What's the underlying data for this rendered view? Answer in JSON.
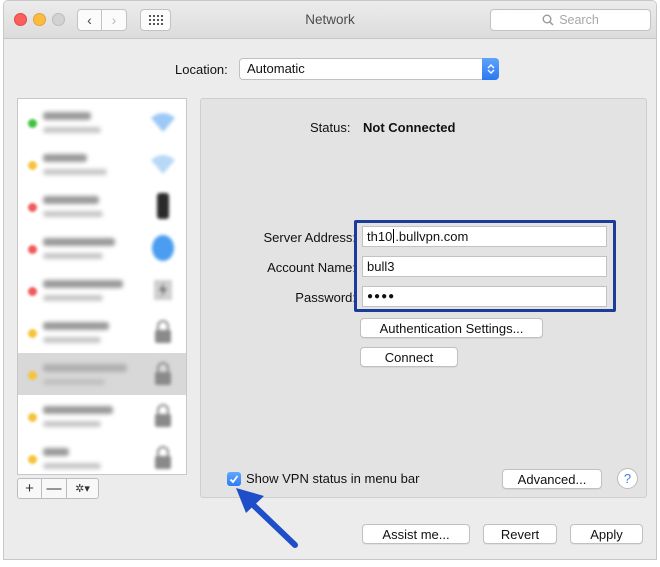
{
  "window": {
    "title": "Network",
    "search_placeholder": "Search"
  },
  "toolbar": {
    "back_glyph": "‹",
    "forward_glyph": "›"
  },
  "location": {
    "label": "Location:",
    "value": "Automatic"
  },
  "status": {
    "label": "Status:",
    "value": "Not Connected"
  },
  "form": {
    "server_label": "Server Address:",
    "server_value_prefix": "th10",
    "server_value_suffix": ".bullvpn.com",
    "account_label": "Account Name:",
    "account_value": "bull3",
    "password_label": "Password:",
    "password_value": "●●●●"
  },
  "buttons": {
    "auth_settings": "Authentication Settings...",
    "connect": "Connect",
    "advanced": "Advanced...",
    "help": "?",
    "assist": "Assist me...",
    "revert": "Revert",
    "apply": "Apply"
  },
  "options": {
    "show_vpn_status": "Show VPN status in menu bar",
    "show_vpn_status_checked": true
  },
  "sidebar_tools": {
    "add": "+",
    "remove": "—",
    "gear": "✲▾"
  },
  "colors": {
    "accent": "#2c7cf4",
    "highlight_box": "#1c3c9c",
    "annotation_arrow": "#1f4ec9",
    "status_green": "#3fc33f",
    "status_yellow": "#f5c33b",
    "status_red": "#f05a5a"
  },
  "icons": {
    "search": "magnifier-icon",
    "grid": "grid-icon",
    "gear": "gear-icon",
    "help": "help-icon",
    "checkmark": "checkmark-icon",
    "annotation": "arrow-icon"
  }
}
